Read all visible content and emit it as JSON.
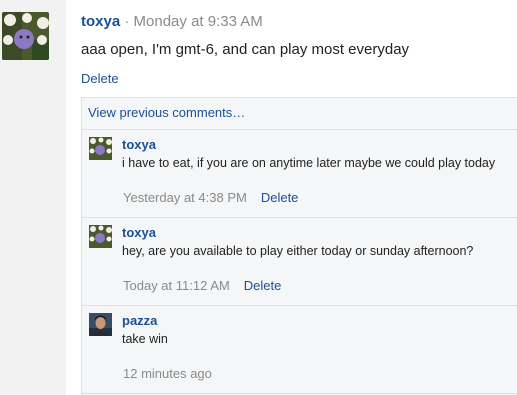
{
  "post": {
    "author": "toxya",
    "separator": " · ",
    "timestamp": "Monday at 9:33 AM",
    "text": "aaa open, I'm gmt-6, and can play most everyday",
    "delete_label": "Delete"
  },
  "comments": {
    "view_previous": "View previous comments…",
    "items": [
      {
        "author": "toxya",
        "text": "i have to eat, if you are on anytime later maybe we could play today",
        "time": "Yesterday at 4:38 PM",
        "delete_label": "Delete"
      },
      {
        "author": "toxya",
        "text": "hey, are you available to play either today or sunday afternoon?",
        "time": "Today at 11:12 AM",
        "delete_label": "Delete"
      },
      {
        "author": "pazza",
        "text": "take win",
        "time": "12 minutes ago"
      }
    ]
  },
  "colors": {
    "link": "#1b4f96",
    "muted": "#8a8a8a",
    "comment_bg": "#f5f6f7",
    "gutter_bg": "#f2f2f2"
  }
}
